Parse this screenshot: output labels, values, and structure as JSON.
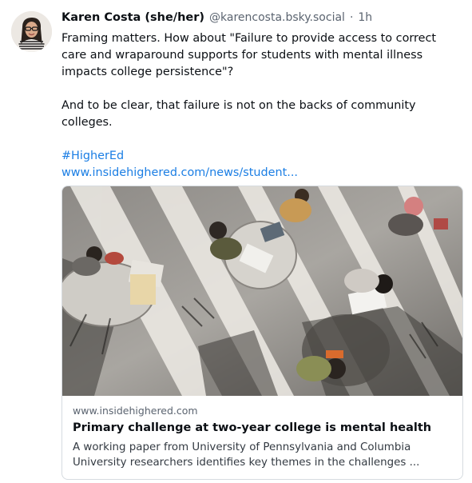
{
  "post": {
    "author_name": "Karen Costa (she/her)",
    "author_handle": "@karencosta.bsky.social",
    "separator": "·",
    "time_ago": "1h",
    "paragraph_1": "Framing matters. How about \"Failure to provide access to correct care and wraparound supports for students with mental illness impacts college persistence\"?",
    "paragraph_2": "And to be clear, that failure is not on the backs of community colleges.",
    "hashtag": "#HigherEd",
    "link_text": "www.insidehighered.com/news/student..."
  },
  "link_card": {
    "domain": "www.insidehighered.com",
    "title": "Primary challenge at two-year college is mental health",
    "description": "A working paper from University of Pennsylvania and Columbia University researchers identifies key themes in the challenges ..."
  },
  "colors": {
    "link": "#1b7ee4",
    "handle": "#5b6470",
    "border": "#d6dbe0"
  }
}
